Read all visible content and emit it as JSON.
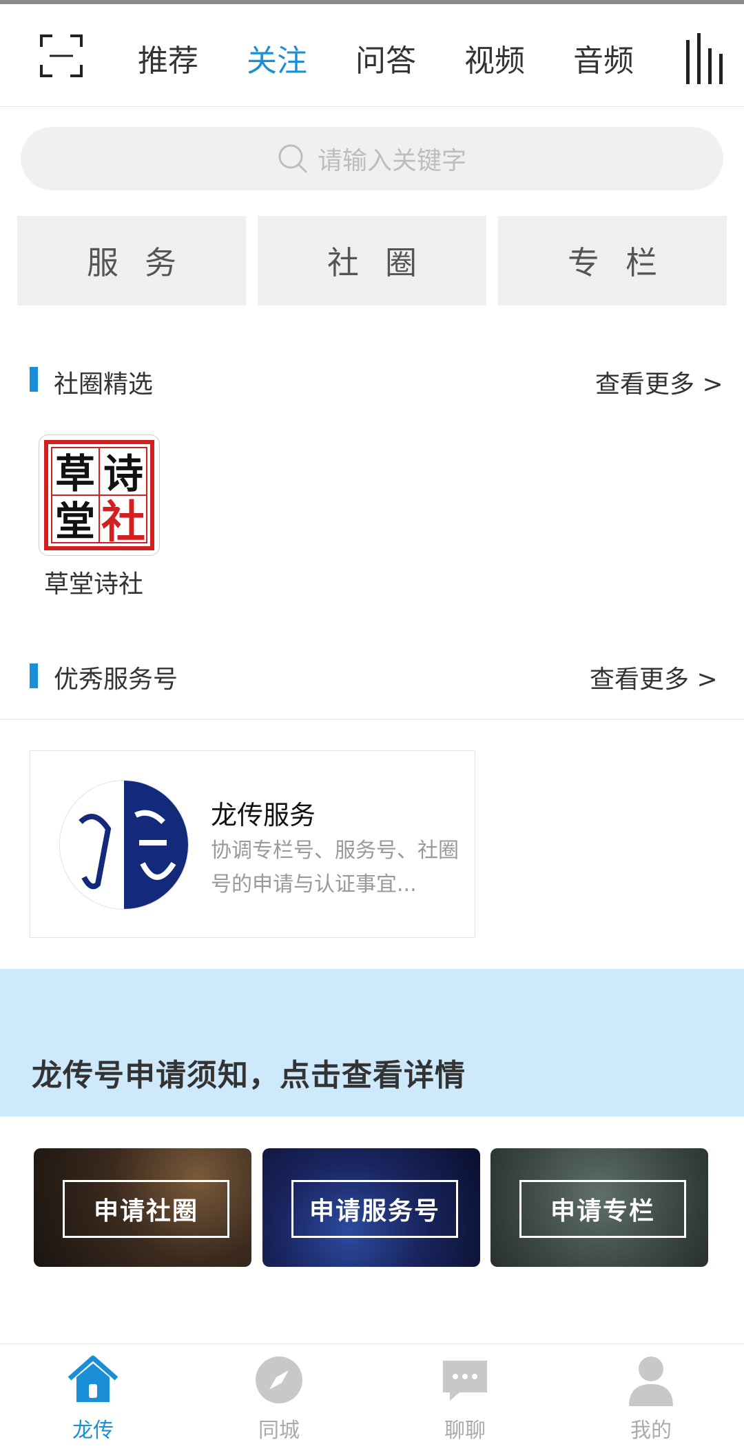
{
  "header": {
    "tabs": [
      {
        "label": "推荐",
        "active": false
      },
      {
        "label": "关注",
        "active": true
      },
      {
        "label": "问答",
        "active": false
      },
      {
        "label": "视频",
        "active": false
      },
      {
        "label": "音频",
        "active": false
      }
    ],
    "icons": {
      "scan": "scan-icon",
      "menu": "menu-bars-icon"
    },
    "accent_color": "#1a8fd8"
  },
  "search": {
    "placeholder": "请输入关键字",
    "icon": "search-icon"
  },
  "categories": [
    {
      "label": "服务"
    },
    {
      "label": "社圈"
    },
    {
      "label": "专栏"
    }
  ],
  "circles_section": {
    "title": "社圈精选",
    "more": "查看更多 >",
    "items": [
      {
        "name": "草堂诗社",
        "logo_chars": [
          "草",
          "诗",
          "堂",
          "社"
        ]
      }
    ]
  },
  "services_section": {
    "title": "优秀服务号",
    "more": "查看更多 >",
    "items": [
      {
        "name": "龙传服务",
        "desc": "协调专栏号、服务号、社圈号的申请与认证事宜..."
      }
    ]
  },
  "notice": {
    "text": "龙传号申请须知，点击查看详情",
    "bg_color": "#cde9fb"
  },
  "apply_tiles": [
    {
      "label": "申请社圈"
    },
    {
      "label": "申请服务号"
    },
    {
      "label": "申请专栏"
    }
  ],
  "bottom_nav": [
    {
      "label": "龙传",
      "icon": "home-icon",
      "active": true
    },
    {
      "label": "同城",
      "icon": "compass-icon",
      "active": false
    },
    {
      "label": "聊聊",
      "icon": "chat-icon",
      "active": false
    },
    {
      "label": "我的",
      "icon": "user-icon",
      "active": false
    }
  ]
}
